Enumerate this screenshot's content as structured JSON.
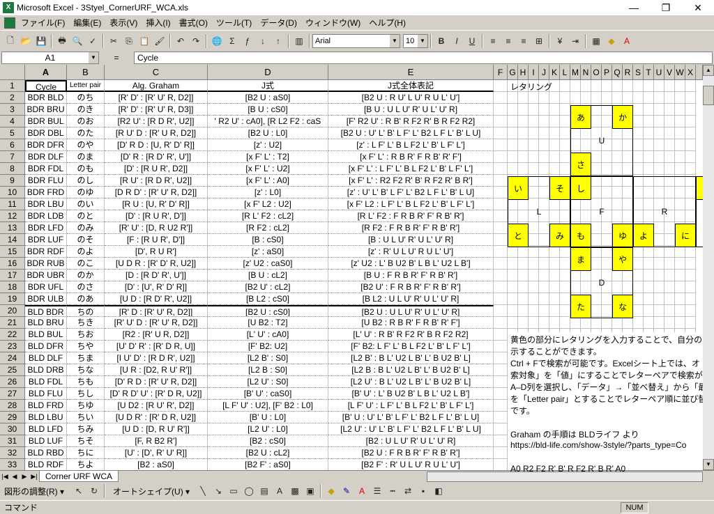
{
  "window": {
    "title": "Microsoft Excel - 3Styel_CornerURF_WCA.xls",
    "minimize": "—",
    "maximize": "❐",
    "close": "✕"
  },
  "menu": [
    "ファイル(F)",
    "編集(E)",
    "表示(V)",
    "挿入(I)",
    "書式(O)",
    "ツール(T)",
    "データ(D)",
    "ウィンドウ(W)",
    "ヘルプ(H)"
  ],
  "toolbar": {
    "font": "Arial",
    "size": "10",
    "bold": "B",
    "italic": "I",
    "underline": "U"
  },
  "formula": {
    "cell": "A1",
    "eq": "=",
    "content": "Cycle"
  },
  "columns": [
    "A",
    "B",
    "C",
    "D",
    "E",
    "F",
    "G",
    "H",
    "I",
    "J",
    "K",
    "L",
    "M",
    "N",
    "O",
    "P",
    "Q",
    "R",
    "S",
    "T",
    "U",
    "V",
    "W",
    "X"
  ],
  "headers": {
    "a": "Cycle",
    "b": "Letter pair",
    "c": "Alg. Graham",
    "d": "J式",
    "e": "J式全体表記",
    "f": "レタリング"
  },
  "rows": [
    [
      "BDR BLD",
      "のち",
      "[R' D' : [R' U' R, D2]]",
      "[B2 U : aS0]",
      "[B2 U : R U' L U' R U L' U']"
    ],
    [
      "BDR BRU",
      "のき",
      "[R' D' : [R' U' R, D3]]",
      "[B U : cS0]",
      "[B U : U L U' R' U L' U' R]"
    ],
    [
      "BDR BUL",
      "のお",
      "[R2 U' : [R D R', U2]]",
      "' R2 U' : cA0], [R L2 F2 : caS",
      "[F' R2 U' : R B' R F2 R' B R F2 R2]"
    ],
    [
      "BDR DBL",
      "のた",
      "[R U' D : [R' U R, D2]]",
      "[B2 U : L0]",
      "[B2 U : U' L' B' L F' L' B2 L F L' B' L U]"
    ],
    [
      "BDR DFR",
      "のや",
      "[D' R D : [U, R' D' R]]",
      "[z' : U2]",
      "[z' : L F' L' B L F2 L' B' L F' L']"
    ],
    [
      "BDR DLF",
      "のま",
      "[D' R : [R D' R', U']]",
      "[x F' L' : T2]",
      "[x F' L' : R B R' F R B' R' F']"
    ],
    [
      "BDR FDL",
      "のも",
      "[D' : [R U R', D2]]",
      "[x F' L' : U2]",
      "[x F' L' : L F' L' B L F2 L' B' L F' L']"
    ],
    [
      "BDR FLU",
      "のし",
      "[R U' : [R D R', U2]]",
      "[x F' L' : A0]",
      "[x F' L' : R2 F2 R' B' R F2 R' B R']"
    ],
    [
      "BDR FRD",
      "のゆ",
      "[D R D' : [R' U' R, D2]]",
      "[z' : L0]",
      "[z' : U' L' B' L F' L' B2 L F L' B' L U]"
    ],
    [
      "BDR LBU",
      "のい",
      "[R U : [U, R' D' R]]",
      "[x F' L2 : U2]",
      "[x F' L2 : L F' L' B L F2 L' B' L F' L']"
    ],
    [
      "BDR LDB",
      "のと",
      "[D' : [R U R', D']]",
      "[R L' F2 : cL2]",
      "[R L' F2 : F R B R' F' R B' R']"
    ],
    [
      "BDR LFD",
      "のみ",
      "[R' U' : [D, R U2 R']]",
      "[R F2 : cL2]",
      "[R F2 : F R B R' F' R B' R']"
    ],
    [
      "BDR LUF",
      "のそ",
      "[F : [R U R', D']]",
      "[B : cS0]",
      "[B : U L U' R' U L' U' R]"
    ],
    [
      "BDR RDF",
      "のよ",
      "[D', R U R']",
      "[z' : aS0]",
      "[z' : R' U L U' R U L' U']"
    ],
    [
      "BDR RUB",
      "のこ",
      "[U D R : [R' D' R, U2]]",
      "[z' U2 : caS0]",
      "[z' U2 : L' B U2 B' L B L' U2 L B']"
    ],
    [
      "BDR UBR",
      "のか",
      "[D : [R D' R', U']]",
      "[B U : cL2]",
      "[B U : F R B R' F' R B' R']"
    ],
    [
      "BDR UFL",
      "のさ",
      "[D' : [U', R' D' R]]",
      "[B2 U' : cL2]",
      "[B2 U' : F R B R' F' R B' R']"
    ],
    [
      "BDR ULB",
      "のあ",
      "[U D : [R D' R', U2]]",
      "[B L2 : cS0]",
      "[B L2 : U L U' R' U L' U' R]"
    ],
    [
      "BLD BDR",
      "ちの",
      "[R' D : [R' U' R, D2]]",
      "[B2 U : cS0]",
      "[B2 U : U L U' R' U L' U' R]"
    ],
    [
      "BLD BRU",
      "ちき",
      "[R' U' D : [R' U' R, D2]]",
      "[U B2 : T2]",
      "[U B2 : R B R' F R B' R' F']"
    ],
    [
      "BLD BUL",
      "ちお",
      "[R2 : [R' U R, D2]]",
      "[L' U' : cA0]",
      "[L' U' : R B' R F2 R' B R F2 R2]"
    ],
    [
      "BLD DFR",
      "ちや",
      "[U' D' R' : [R' D R, U]]",
      "[F' B2: U2]",
      "[F' B2: L F' L' B L F2 L' B' L F' L']"
    ],
    [
      "BLD DLF",
      "ちま",
      "[I U' D' : [R D R', U2]]",
      "[L2 B' : S0]",
      "[L2 B' : B L' U2 L B' L' B U2 B' L]"
    ],
    [
      "BLD DRB",
      "ちな",
      "[U R : [D2, R U' R']]",
      "[L2 B : S0]",
      "[L2 B : B L' U2 L B' L' B U2 B' L]"
    ],
    [
      "BLD FDL",
      "ちも",
      "[D' R D : [R' U' R, D2]]",
      "[L2 U' : S0]",
      "[L2 U' : B L' U2 L B' L' B U2 B' L]"
    ],
    [
      "BLD FLU",
      "ちし",
      "[D' R D' U' : [R' D R, U2]]",
      "[B' U' : caS0]",
      "[B' U' : L' B U2 B' L B L' U2 L B']"
    ],
    [
      "BLD FRD",
      "ちゆ",
      "[U D2 : [R U' R', D2]]",
      "[L F' U' : U2], [F' B2 : L0]",
      "[L F' U' : L F' L' B L F2 L' B' L F' L']"
    ],
    [
      "BLD LBU",
      "ちい",
      "[U D R' : [R' D R, U2]]",
      "[B' U : L0]",
      "[B' U : U' L' B' L F' L' B2 L F L' B' L U]"
    ],
    [
      "BLD LFD",
      "ちみ",
      "[U D : [D, R U' R']]",
      "[L2 U' : L0]",
      "[L2 U' : U' L' B' L F' L' B2 L F L' B' L U]"
    ],
    [
      "BLD LUF",
      "ちそ",
      "[F, R B2 R']",
      "[B2 : cS0]",
      "[B2 : U L U' R' U L' U' R]"
    ],
    [
      "BLD RBD",
      "ちに",
      "[U' : [D', R' U' R]]",
      "[B2 U : cL2]",
      "[B2 U : F R B R' F' R B' R']"
    ],
    [
      "BLD RDF",
      "ちよ",
      "[B2 : aS0]",
      "[B2 F' : aS0]",
      "[B2 F' : R' U L U' R U L' U']"
    ]
  ],
  "panel": {
    "grid_chars": {
      "a": "あ",
      "ka": "か",
      "u": "U",
      "sa": "さ",
      "i": "い",
      "so": "そ",
      "shi": "し",
      "ko": "こ",
      "l": "L",
      "f": "F",
      "r": "R",
      "to": "と",
      "mi": "み",
      "mo": "も",
      "yu": "ゆ",
      "yo": "よ",
      "ni": "に",
      "ma": "ま",
      "ya": "や",
      "d": "D",
      "ta": "た",
      "na": "な"
    },
    "notes": [
      "黄色の部分にレタリングを入力することで、自分のレタ",
      "示することができます。",
      "Ctrl + Fで検索が可能です。Excelシート上では、オ",
      "索対象」を「値」にすることでレターペアで検索ができ",
      "A–D列を選択し、「データ」→「並べ替え」から「最優",
      "を「Letter pair」とすることでレターペア順に並び替え",
      "です。",
      "",
      "Graham の手順は BLDライフ より",
      "https://bld-life.com/show-3style/?parts_type=Co",
      "",
      "A0       R2 F2 R' B' R F2 R' B R'   A0"
    ]
  },
  "sheet_tab": "Corner URF WCA",
  "drawbar": {
    "shape_adjust": "図形の調整(R) ▾",
    "autoshape": "オートシェイプ(U) ▾"
  },
  "status": {
    "mode": "コマンド",
    "num": "NUM"
  }
}
